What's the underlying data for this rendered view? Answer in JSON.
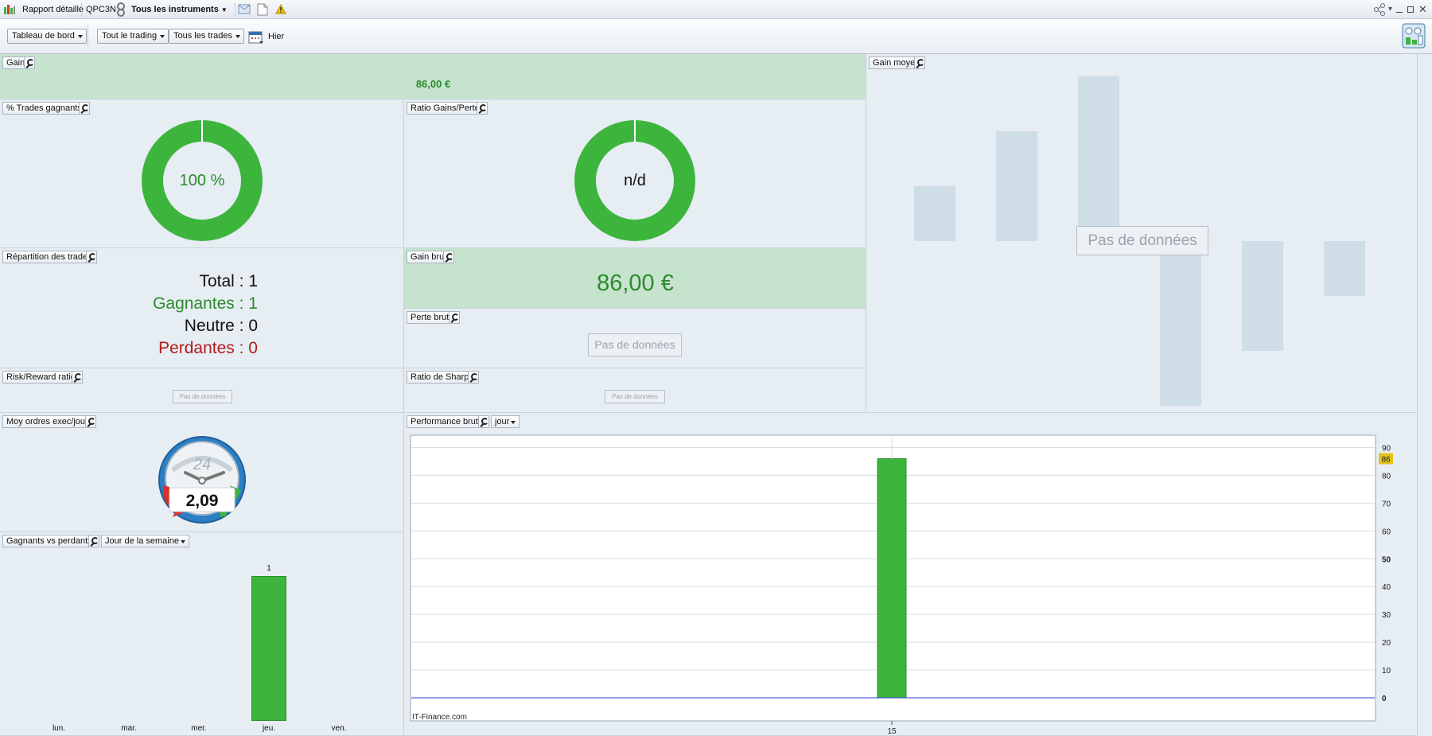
{
  "titlebar": {
    "report_label": "Rapport détaillé",
    "account": "QPC3N",
    "instruments": "Tous les instruments"
  },
  "toolbar": {
    "dashboard": "Tableau de bord",
    "trading": "Tout le trading",
    "trades": "Tous les trades",
    "period": "Hier"
  },
  "widgets": {
    "gain": {
      "title": "Gain",
      "value": "86,00 €"
    },
    "gain_moyen": {
      "title": "Gain moyen",
      "no_data": "Pas de données"
    },
    "pct_trades_gagnants": {
      "title": "% Trades gagnants",
      "value": "100 %",
      "fraction": 1.0
    },
    "ratio_gains_pertes": {
      "title": "Ratio Gains/Pertes",
      "value": "n/d"
    },
    "repartition": {
      "title": "Répartition des trades",
      "total": "Total : 1",
      "gagnantes": "Gagnantes : 1",
      "neutre": "Neutre : 0",
      "perdantes": "Perdantes : 0"
    },
    "gain_brut": {
      "title": "Gain brut",
      "value": "86,00 €"
    },
    "perte_brute": {
      "title": "Perte brute",
      "no_data": "Pas de données"
    },
    "risk_reward": {
      "title": "Risk/Reward ratio",
      "no_data": "Pas de données"
    },
    "sharpe": {
      "title": "Ratio de Sharpe",
      "no_data": "Pas de données"
    },
    "moy_ordres": {
      "title": "Moy ordres exec/jour",
      "dial_label": "24",
      "value": "2,09"
    },
    "gagnants_vs_perdants": {
      "title": "Gagnants vs perdants",
      "dropdown": "Jour de la semaine"
    },
    "performance_brute": {
      "title": "Performance brute",
      "dropdown": "jour",
      "watermark": "IT-Finance.com",
      "current_value": "86"
    }
  },
  "colors": {
    "gain_green": "#3db53d",
    "text_green": "#2c8a2c",
    "loss_red": "#b01c1c",
    "highlight": "#e6c21e"
  },
  "chart_data": [
    {
      "type": "bar",
      "categories": [
        "lun.",
        "mar.",
        "mer.",
        "jeu.",
        "ven."
      ],
      "values": [
        0,
        0,
        0,
        1,
        0
      ],
      "data_labels": [
        "",
        "",
        "",
        "1",
        ""
      ],
      "ylim": [
        0,
        1.1
      ]
    },
    {
      "type": "bar",
      "categories": [
        "15"
      ],
      "values": [
        86
      ],
      "yticks": [
        "0",
        "10",
        "20",
        "30",
        "40",
        "50",
        "60",
        "70",
        "80",
        "90"
      ],
      "ylim": [
        0,
        95
      ],
      "grid": true
    }
  ]
}
